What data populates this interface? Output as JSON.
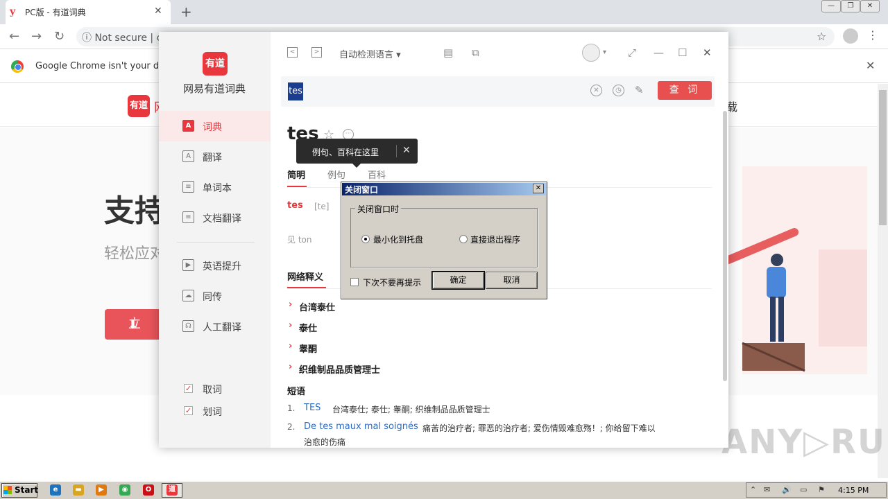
{
  "browser": {
    "tab_title": "PC版 - 有道词典",
    "tab_favicon": "y",
    "close": "✕",
    "new_tab": "+",
    "not_secure": "ⓘ  Not secure  |  c",
    "infobar_text": "Google Chrome isn't your default",
    "win_buttons": [
      "—",
      "❐",
      "✕"
    ],
    "nav_icons": [
      "back-icon",
      "forward-icon",
      "reload-icon"
    ],
    "nav_glyphs": [
      "←",
      "→",
      "↻"
    ],
    "star": "☆",
    "menu": "⋮"
  },
  "site": {
    "logo_text": "有道",
    "logo_tail": "网",
    "download": "载",
    "hero_title": "支持",
    "hero_sub": "轻松应对",
    "hero_btn": "立",
    "hero_btn_icon": "⬇",
    "watermark": "ANY▷RUN"
  },
  "app": {
    "logo_text": "有道",
    "name": "网易有道词典",
    "sidebar": [
      {
        "icon": "A",
        "label": "词典"
      },
      {
        "icon": "A",
        "label": "翻译"
      },
      {
        "icon": "≡",
        "label": "单词本"
      },
      {
        "icon": "≡",
        "label": "文档翻译"
      },
      {
        "icon": "▶",
        "label": "英语提升"
      },
      {
        "icon": "☁",
        "label": "同传"
      },
      {
        "icon": "☊",
        "label": "人工翻译"
      }
    ],
    "checks": [
      {
        "label": "取词",
        "checked": true
      },
      {
        "label": "划词",
        "checked": true
      }
    ],
    "check_mark": "✓",
    "lang_select": "自动检测语言 ▾",
    "nav_back": "<",
    "nav_forward": ">",
    "toolbar_glyphs": {
      "doc": "▤",
      "screenshot": "⧉",
      "expand": "⤢",
      "minimize": "—",
      "maximize": "☐",
      "close": "✕"
    },
    "search": {
      "value": "tes",
      "button": "查 词",
      "clear": "✕",
      "history": "◷",
      "edit": "✎"
    },
    "word": "tes",
    "word_star": "☆",
    "word_more": "···",
    "tooltip": "例句、百科在这里",
    "tooltip_close": "✕",
    "tabs": [
      "简明",
      "例句",
      "百科"
    ],
    "entry": {
      "word": "tes",
      "phonetic": "[te]",
      "see": "见 ton"
    },
    "net_title": "网络释义",
    "net_arrow": "›",
    "net_items": [
      "台湾泰仕",
      "泰仕",
      "睾酮",
      "织维制品品质管理士"
    ],
    "phrase_title": "短语",
    "phrases": [
      {
        "num": "1.",
        "key": "TES",
        "val": "台湾泰仕;  泰仕;  睾酮;  织维制品品质管理士"
      },
      {
        "num": "2.",
        "key": "De tes maux mal soignés",
        "val": "痛苦的治疗者;  罪恶的治疗者;  爱伤情毁难愈殇！;  你给留下难以",
        "val2": "治愈的伤痛"
      }
    ]
  },
  "dialog": {
    "title": "关闭窗口",
    "close": "✕",
    "group_label": "关闭窗口时",
    "option_minimize": "最小化到托盘",
    "option_exit": "直接退出程序",
    "selected": "minimize",
    "dont_show": "下次不要再提示",
    "ok": "确定",
    "cancel": "取消"
  },
  "taskbar": {
    "start": "Start",
    "clock": "4:15 PM",
    "tray_glyphs": [
      "⌃",
      "✉",
      "🔊",
      "▭",
      "⚑"
    ],
    "app_icons": [
      {
        "name": "ie-icon",
        "glyph": "e",
        "color": "#1e73be"
      },
      {
        "name": "folder-icon",
        "glyph": "▬",
        "color": "#d9a520"
      },
      {
        "name": "media-icon",
        "glyph": "▶",
        "color": "#e07a10"
      },
      {
        "name": "chrome-icon",
        "glyph": "◉",
        "color": "#34a853"
      },
      {
        "name": "opera-icon",
        "glyph": "O",
        "color": "#cc0f16"
      },
      {
        "name": "youdao-icon",
        "glyph": "道",
        "color": "#e8383d"
      }
    ]
  },
  "colors": {
    "accent": "#e8383d",
    "link": "#2b6cc4",
    "dialog_title": "#0a246a"
  }
}
